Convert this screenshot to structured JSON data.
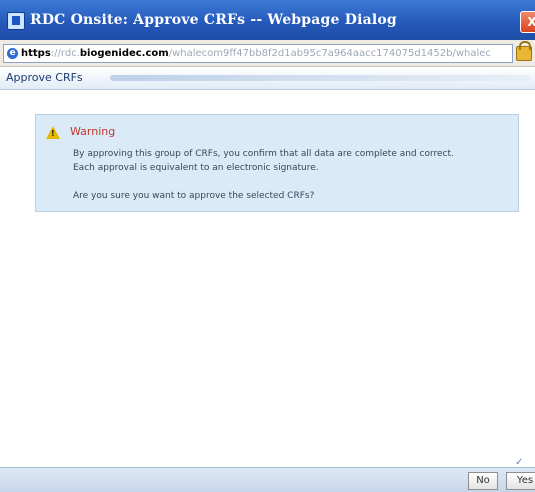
{
  "window": {
    "title": "RDC Onsite: Approve CRFs -- Webpage Dialog",
    "close_label": "X"
  },
  "address": {
    "scheme": "https",
    "faded_prefix": "://rdc.",
    "domain": "biogenidec.com",
    "faded_path": "/whalecom9ff47bb8f2d1ab95c7a964aacc174075d1452b/whalec"
  },
  "header": {
    "title": "Approve CRFs"
  },
  "warning": {
    "title": "Warning",
    "line1": "By approving this group of CRFs, you confirm that all data are complete and correct.",
    "line2": "Each approval is equivalent to an electronic signature.",
    "question": "Are you sure you want to approve the selected CRFs?"
  },
  "buttons": {
    "no_label": "No",
    "yes_label": "Yes"
  }
}
